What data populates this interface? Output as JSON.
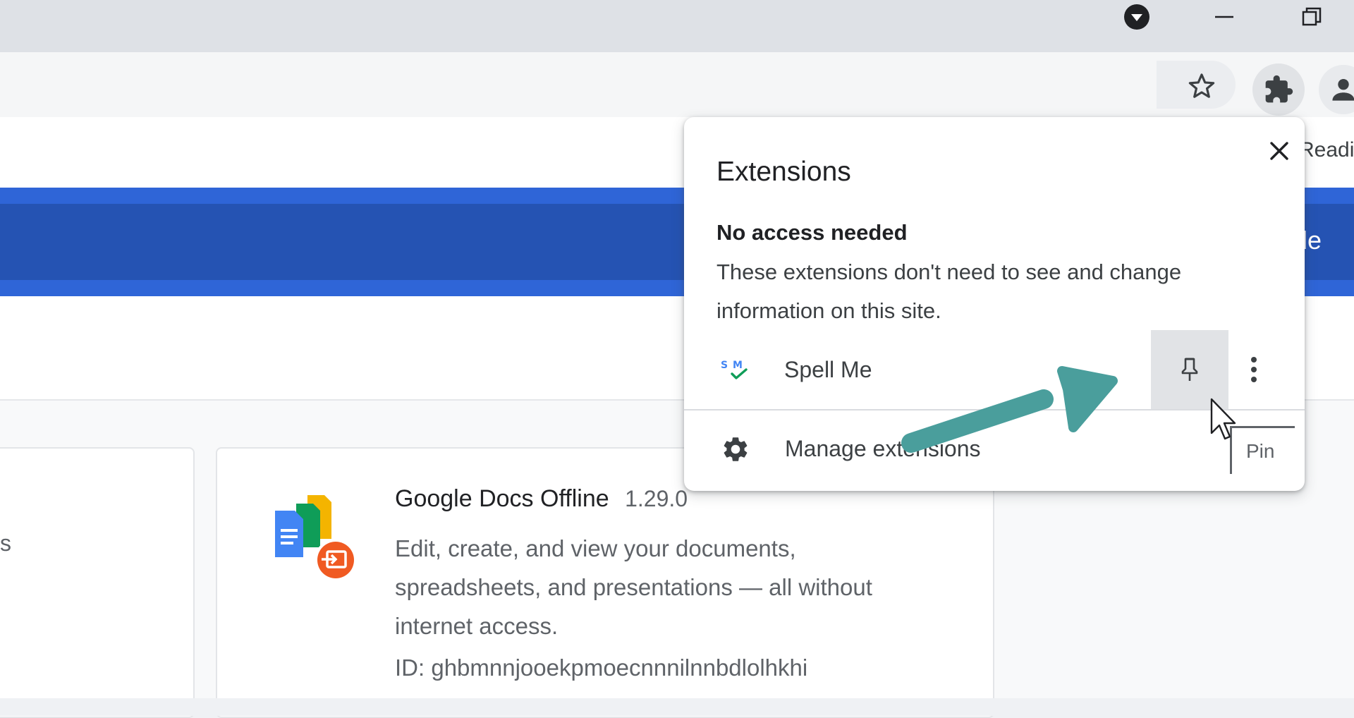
{
  "window": {
    "controls": [
      "profile-menu",
      "minimize",
      "restore"
    ]
  },
  "bookmarks_bar": {
    "reading_list_label": "Readi"
  },
  "page": {
    "banner_text": "de",
    "left_card_text": "s",
    "extension_card": {
      "name": "Google Docs Offline",
      "version": "1.29.0",
      "description": "Edit, create, and view your documents, spreadsheets, and presentations — all without internet access.",
      "id": "ID: ghbmnnjooekpmoecnnnilnnbdlolhkhi"
    }
  },
  "extensions_popup": {
    "title": "Extensions",
    "section_heading": "No access needed",
    "section_description": "These extensions don't need to see and change information on this site.",
    "items": [
      {
        "name": "Spell Me",
        "icon": "spell-me-icon"
      }
    ],
    "manage_label": "Manage extensions",
    "pin_tooltip": "Pin"
  },
  "colors": {
    "banner": "#2f65d7",
    "banner_inner": "#2553b3",
    "annotation_arrow": "#4a9e9c",
    "popup_bg": "#ffffff",
    "titlebar": "#dee1e6"
  },
  "icons": [
    "profile-menu-icon",
    "minimize-icon",
    "restore-icon",
    "star-icon",
    "puzzle-icon",
    "account-icon",
    "close-icon",
    "spell-me-icon",
    "pin-icon",
    "more-vert-icon",
    "gear-icon",
    "google-docs-offline-icon",
    "mouse-cursor-icon",
    "annotation-arrow"
  ]
}
